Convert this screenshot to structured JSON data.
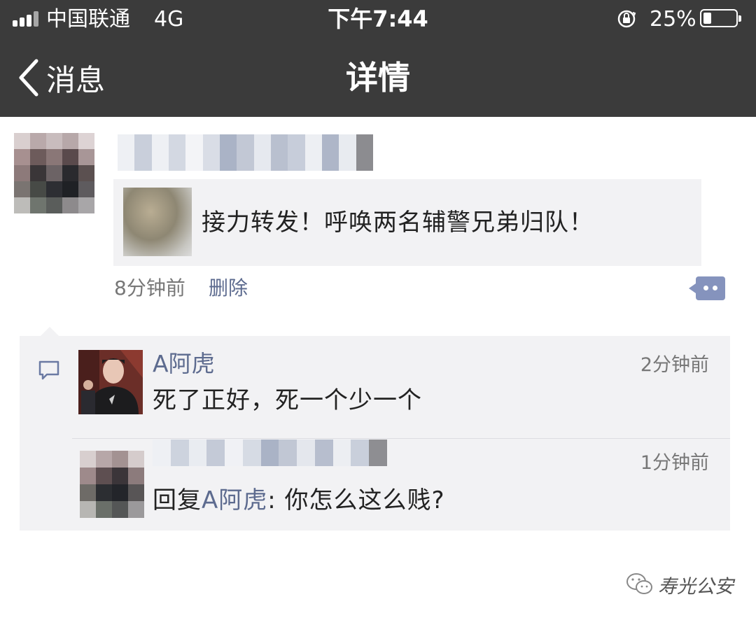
{
  "status_bar": {
    "carrier": "中国联通",
    "network": "4G",
    "time": "下午7:44",
    "battery": "25%",
    "battery_level": 0.25
  },
  "nav": {
    "back_label": "消息",
    "title": "详情"
  },
  "post": {
    "share_text": "接力转发！呼唤两名辅警兄弟归队！",
    "time": "8分钟前",
    "delete_label": "删除"
  },
  "comments": [
    {
      "name": "A阿虎",
      "time": "2分钟前",
      "text": "死了正好，死一个少一个"
    },
    {
      "time": "1分钟前",
      "reply_prefix": "回复",
      "reply_to": "A阿虎",
      "text": ": 你怎么这么贱?"
    }
  ],
  "watermark": "寿光公安",
  "colors": {
    "header_bg": "#3b3b3b",
    "link_blue": "#5d6b8f",
    "card_bg": "#f2f2f4",
    "more_button": "#8593bd"
  }
}
